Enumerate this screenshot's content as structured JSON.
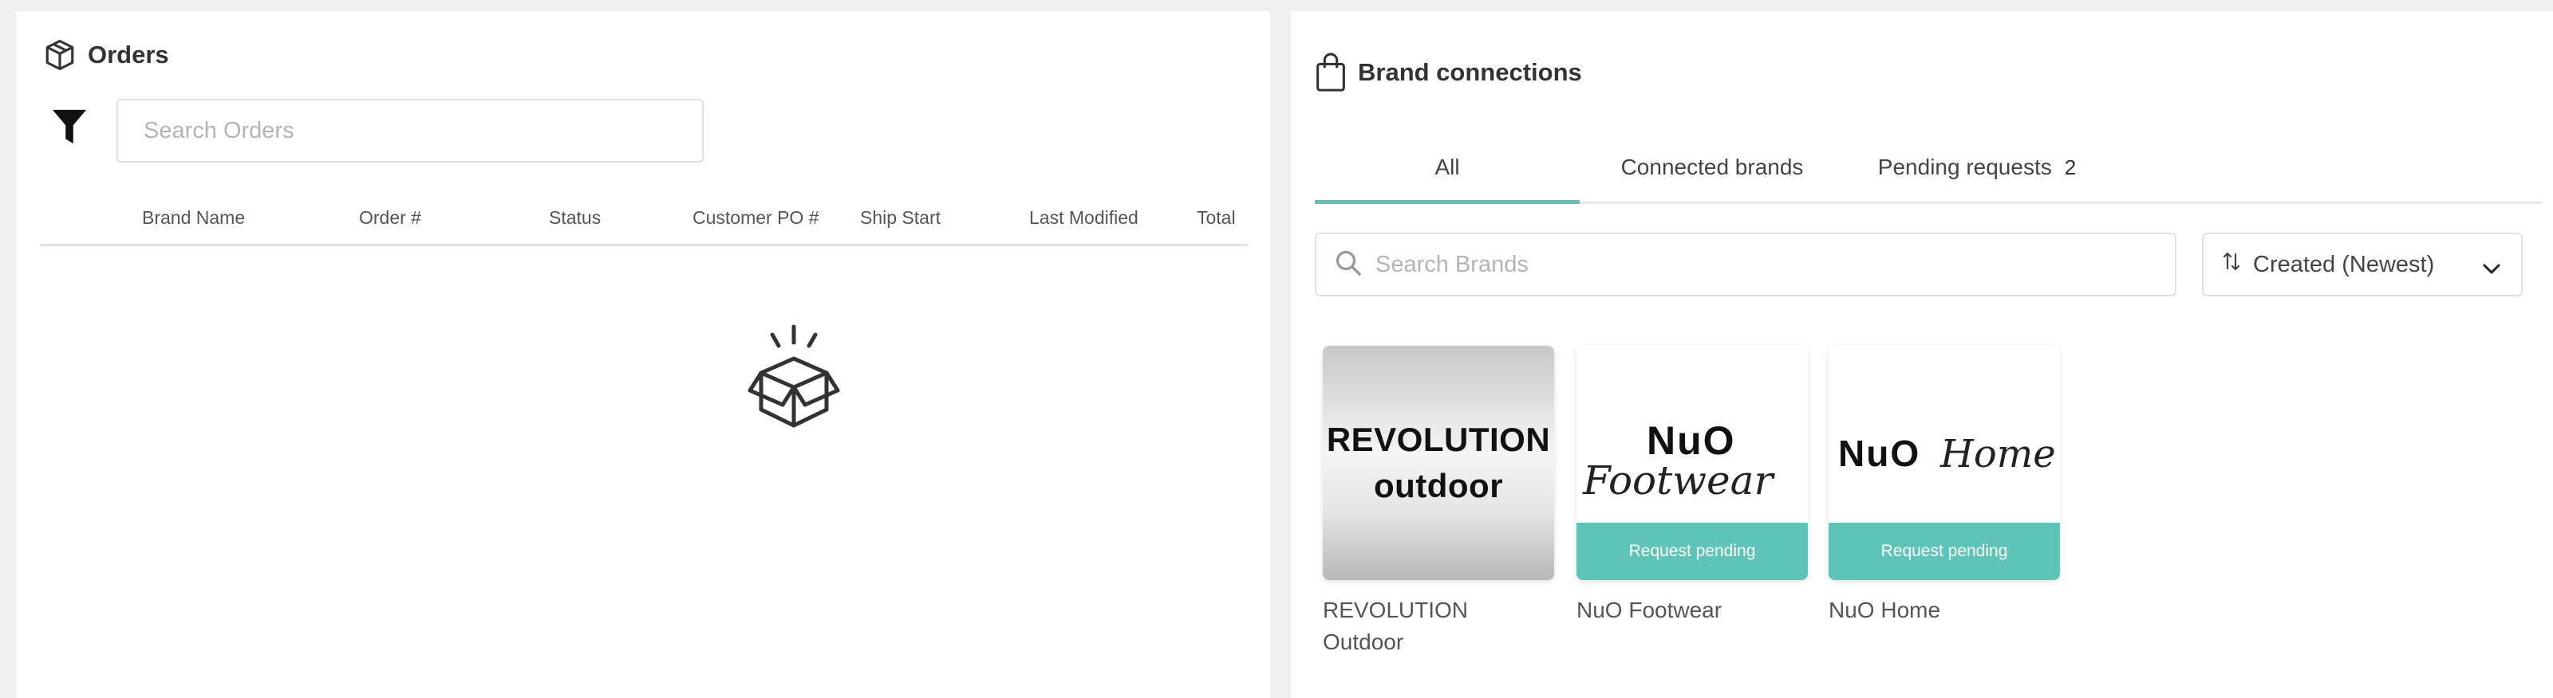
{
  "orders": {
    "title": "Orders",
    "search": {
      "placeholder": "Search Orders",
      "value": ""
    },
    "columns": [
      "Brand Name",
      "Order #",
      "Status",
      "Customer PO #",
      "Ship Start",
      "Last Modified",
      "Total"
    ]
  },
  "brands": {
    "title": "Brand connections",
    "tabs": [
      {
        "label": "All",
        "active": true
      },
      {
        "label": "Connected brands",
        "active": false
      },
      {
        "label": "Pending requests",
        "count": "2",
        "active": false
      }
    ],
    "search": {
      "placeholder": "Search Brands",
      "value": ""
    },
    "sort": {
      "selected": "Created (Newest)"
    },
    "cards": [
      {
        "logo_line1": "REVOLUTION",
        "logo_line2": "outdoor",
        "name": "REVOLUTION Outdoor",
        "status": ""
      },
      {
        "logo_word": "NuO",
        "logo_script": "Footwear",
        "name": "NuO Footwear",
        "status": "Request pending"
      },
      {
        "logo_word": "NuO",
        "logo_script": "Home",
        "name": "NuO Home",
        "status": "Request pending"
      }
    ]
  },
  "colors": {
    "accent": "#5fc4b8",
    "panel_bg": "#ffffff",
    "page_bg": "#f0f0f1",
    "border": "#e1e1e1"
  },
  "icons": [
    "box-icon",
    "filter-icon",
    "empty-box-icon",
    "shopping-bag-icon",
    "search-icon",
    "sort-icon",
    "chevron-down-icon"
  ]
}
